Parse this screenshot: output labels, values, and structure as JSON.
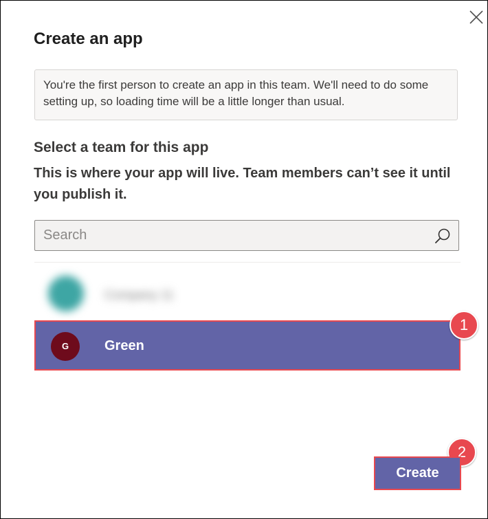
{
  "dialog": {
    "title": "Create an app",
    "close_icon": "close-icon",
    "notice": "You're the first person to create an app in this team. We'll need to do some setting up, so loading time will be a little longer than usual."
  },
  "team_section": {
    "title": "Select a team for this app",
    "description": "This is where your app will live. Team members can’t see it until you publish it."
  },
  "search": {
    "placeholder": "Search",
    "value": "",
    "icon": "search-icon"
  },
  "teams": [
    {
      "name": "Company 11",
      "avatar_initial": "",
      "avatar_color": "#3ea6a4",
      "blurred": true,
      "selected": false
    },
    {
      "name": "Green",
      "avatar_initial": "G",
      "avatar_color": "#6e0b1c",
      "blurred": false,
      "selected": true
    }
  ],
  "annotations": {
    "step1": "1",
    "step2": "2",
    "color": "#e8484f"
  },
  "footer": {
    "create_label": "Create"
  },
  "colors": {
    "accent": "#6264a7",
    "highlight_border": "#e8484f"
  }
}
